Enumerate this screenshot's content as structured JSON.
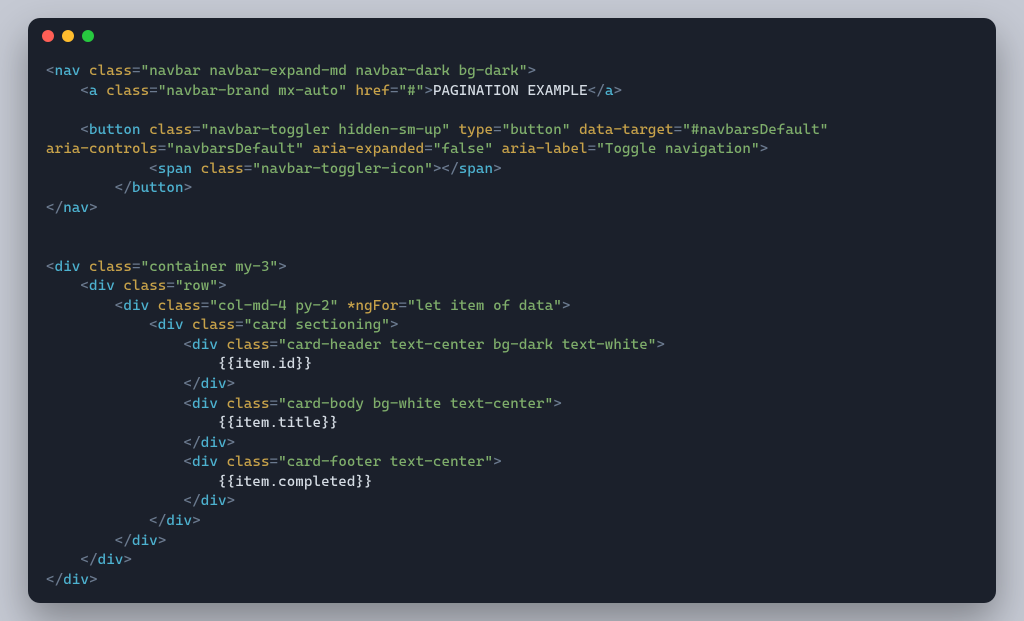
{
  "code": {
    "nav": {
      "open": {
        "tag": "nav",
        "attrs": [
          {
            "name": "class",
            "value": "navbar navbar-expand-md navbar-dark bg-dark"
          }
        ]
      },
      "a": {
        "open": {
          "tag": "a",
          "attrs": [
            {
              "name": "class",
              "value": "navbar-brand mx-auto"
            },
            {
              "name": "href",
              "value": "#"
            }
          ]
        },
        "text": "PAGINATION EXAMPLE",
        "close": {
          "tag": "a"
        }
      },
      "button": {
        "open": {
          "tag": "button",
          "attrs": [
            {
              "name": "class",
              "value": "navbar-toggler hidden-sm-up"
            },
            {
              "name": "type",
              "value": "button"
            },
            {
              "name": "data-target",
              "value": "#navbarsDefault"
            },
            {
              "name": "aria-controls",
              "value": "navbarsDefault"
            },
            {
              "name": "aria-expanded",
              "value": "false"
            },
            {
              "name": "aria-label",
              "value": "Toggle navigation"
            }
          ],
          "wrap_after": 3
        },
        "span": {
          "open": {
            "tag": "span",
            "attrs": [
              {
                "name": "class",
                "value": "navbar-toggler-icon"
              }
            ]
          },
          "close": {
            "tag": "span"
          }
        },
        "close": {
          "tag": "button"
        }
      },
      "close": {
        "tag": "nav"
      }
    },
    "container": {
      "open": {
        "tag": "div",
        "attrs": [
          {
            "name": "class",
            "value": "container my-3"
          }
        ]
      },
      "row": {
        "open": {
          "tag": "div",
          "attrs": [
            {
              "name": "class",
              "value": "row"
            }
          ]
        },
        "col": {
          "open": {
            "tag": "div",
            "attrs": [
              {
                "name": "class",
                "value": "col-md-4 py-2"
              },
              {
                "name": "*ngFor",
                "value": "let item of data"
              }
            ]
          },
          "card": {
            "open": {
              "tag": "div",
              "attrs": [
                {
                  "name": "class",
                  "value": "card sectioning"
                }
              ]
            },
            "header": {
              "open": {
                "tag": "div",
                "attrs": [
                  {
                    "name": "class",
                    "value": "card-header text-center bg-dark text-white"
                  }
                ]
              },
              "expr": "{{item.id}}",
              "close": {
                "tag": "div"
              }
            },
            "body": {
              "open": {
                "tag": "div",
                "attrs": [
                  {
                    "name": "class",
                    "value": "card-body bg-white text-center"
                  }
                ]
              },
              "expr": "{{item.title}}",
              "close": {
                "tag": "div"
              }
            },
            "footer": {
              "open": {
                "tag": "div",
                "attrs": [
                  {
                    "name": "class",
                    "value": "card-footer text-center"
                  }
                ]
              },
              "expr": "{{item.completed}}",
              "close": {
                "tag": "div"
              }
            },
            "close": {
              "tag": "div"
            }
          },
          "close": {
            "tag": "div"
          }
        },
        "close": {
          "tag": "div"
        }
      },
      "close": {
        "tag": "div"
      }
    }
  }
}
